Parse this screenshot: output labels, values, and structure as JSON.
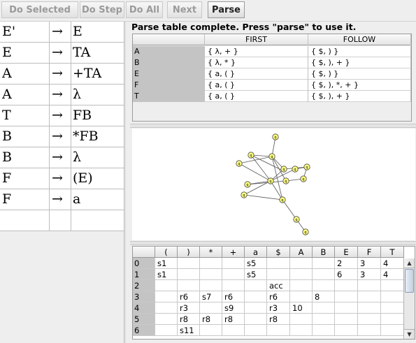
{
  "toolbar": {
    "do_selected": "Do Selected",
    "do_step": "Do Step",
    "do_all": "Do All",
    "next": "Next",
    "parse": "Parse"
  },
  "grammar": {
    "arrow": "→",
    "rows": [
      {
        "lhs": "E'",
        "rhs": "E"
      },
      {
        "lhs": "E",
        "rhs": "TA"
      },
      {
        "lhs": "A",
        "rhs": "+TA"
      },
      {
        "lhs": "A",
        "rhs": "λ"
      },
      {
        "lhs": "T",
        "rhs": "FB"
      },
      {
        "lhs": "B",
        "rhs": "*FB"
      },
      {
        "lhs": "B",
        "rhs": "λ"
      },
      {
        "lhs": "F",
        "rhs": "(E)"
      },
      {
        "lhs": "F",
        "rhs": "a"
      },
      {
        "lhs": "",
        "rhs": ""
      }
    ]
  },
  "status": "Parse table complete.  Press \"parse\" to use it.",
  "first_follow": {
    "headers": [
      "",
      "FIRST",
      "FOLLOW"
    ],
    "rows": [
      [
        "A",
        "{ λ, + }",
        "{ $, ) }"
      ],
      [
        "B",
        "{ λ, * }",
        "{ $, ), + }"
      ],
      [
        "E",
        "{ a, ( }",
        "{ $, ) }"
      ],
      [
        "F",
        "{ a, ( }",
        "{ $, ), *, + }"
      ],
      [
        "T",
        "{ a, ( }",
        "{ $, ), + }"
      ]
    ]
  },
  "lr_table": {
    "headers": [
      "",
      "(",
      ")",
      "*",
      "+",
      "a",
      "$",
      "A",
      "B",
      "E",
      "F",
      "T"
    ],
    "rows": [
      [
        "0",
        "s1",
        "",
        "",
        "",
        "s5",
        "",
        "",
        "",
        "2",
        "3",
        "4"
      ],
      [
        "1",
        "s1",
        "",
        "",
        "",
        "s5",
        "",
        "",
        "",
        "6",
        "3",
        "4"
      ],
      [
        "2",
        "",
        "",
        "",
        "",
        "",
        "acc",
        "",
        "",
        "",
        "",
        ""
      ],
      [
        "3",
        "",
        "r6",
        "s7",
        "r6",
        "",
        "r6",
        "",
        "8",
        "",
        "",
        ""
      ],
      [
        "4",
        "",
        "r3",
        "",
        "s9",
        "",
        "r3",
        "10",
        "",
        "",
        "",
        ""
      ],
      [
        "5",
        "",
        "r8",
        "r8",
        "r8",
        "",
        "r8",
        "",
        "",
        "",
        "",
        ""
      ],
      [
        "6",
        "",
        "s11",
        "",
        "",
        "",
        "",
        "",
        "",
        "",
        "",
        ""
      ]
    ]
  },
  "colors": {
    "node_fill": "#ffff80",
    "row_header": "#c4c4c4"
  }
}
